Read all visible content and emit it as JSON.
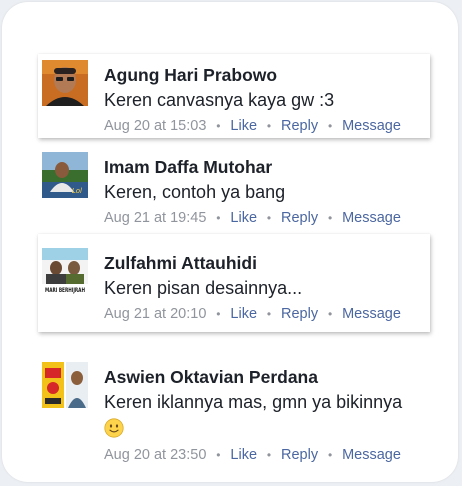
{
  "colors": {
    "page_bg": "#eceff3",
    "panel_bg": "#ffffff",
    "author_text": "#1d2129",
    "meta_text": "#90949c",
    "link": "#4b67a1"
  },
  "actions": {
    "like": "Like",
    "reply": "Reply",
    "message": "Message",
    "separator": "•"
  },
  "comments": [
    {
      "author": "Agung Hari Prabowo",
      "text": "Keren canvasnya kaya gw :3",
      "timestamp": "Aug 20 at 15:03",
      "avatar_icon": "man-glasses-photo"
    },
    {
      "author": "Imam Daffa Mutohar",
      "text": "Keren, contoh ya bang",
      "timestamp": "Aug 21 at 19:45",
      "avatar_icon": "man-outdoor-photo"
    },
    {
      "author": "Zulfahmi Attauhidi",
      "text": "Keren pisan desainnya...",
      "timestamp": "Aug 21 at 20:10",
      "avatar_icon": "poster-photo",
      "avatar_caption": "MARI BERHIJRAH"
    },
    {
      "author": "Aswien Oktavian Perdana",
      "text": "Keren iklannya mas, gmn ya bikinnya",
      "timestamp": "Aug 20 at 23:50",
      "avatar_icon": "ad-poster-photo",
      "emoji": "slightly-smiling-face-icon"
    }
  ]
}
